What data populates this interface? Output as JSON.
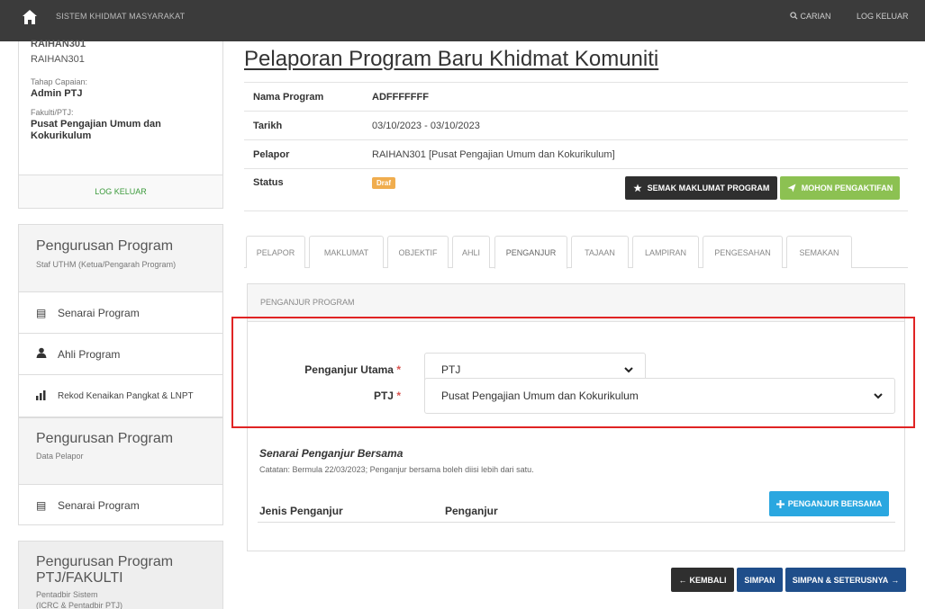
{
  "topbar": {
    "brand": "SISTEM KHIDMAT MASYARAKAT",
    "search": "CARIAN",
    "logout": "LOG KELUAR"
  },
  "profile": {
    "name_cut": "RAIHAN301",
    "username": "RAIHAN301",
    "level_label": "Tahap Capaian:",
    "level": "Admin PTJ",
    "faculty_label": "Fakulti/PTJ:",
    "faculty": "Pusat Pengajian Umum dan Kokurikulum",
    "logout": "LOG KELUAR"
  },
  "sidebar": {
    "section1": {
      "title": "Pengurusan Program",
      "subtitle": "Staf UTHM (Ketua/Pengarah Program)",
      "items": [
        "Senarai Program",
        "Ahli Program",
        "Rekod Kenaikan Pangkat & LNPT"
      ]
    },
    "section2": {
      "title": "Pengurusan Program",
      "subtitle": "Data Pelapor",
      "items": [
        "Senarai Program"
      ]
    },
    "section3": {
      "title": "Pengurusan Program",
      "title2": "PTJ/FAKULTI",
      "subtitle": "Pentadbir Sistem",
      "subtitle2": "(ICRC & Pentadbir PTJ)"
    }
  },
  "page": {
    "title": "Pelaporan Program Baru Khidmat Komuniti"
  },
  "info": {
    "program_label": "Nama Program",
    "program": "ADFFFFFFF",
    "date_label": "Tarikh",
    "date": "03/10/2023 - 03/10/2023",
    "reporter_label": "Pelapor",
    "reporter": "RAIHAN301 [Pusat Pengajian Umum dan Kokurikulum]",
    "status_label": "Status",
    "status": "Draf"
  },
  "actions": {
    "check": "SEMAK MAKLUMAT PROGRAM",
    "activate": "MOHON PENGAKTIFAN"
  },
  "tabs": [
    "PELAPOR",
    "MAKLUMAT",
    "OBJEKTIF",
    "AHLI",
    "PENGANJUR",
    "TAJAAN",
    "LAMPIRAN",
    "PENGESAHAN",
    "SEMAKAN"
  ],
  "panel": {
    "header": "PENGANJUR PROGRAM",
    "main_organizer_label": "Penganjur Utama",
    "main_organizer_value": "PTJ",
    "ptj_label": "PTJ",
    "ptj_value": "Pusat Pengajian Umum dan Kokurikulum",
    "required_mark": "*",
    "co_title": "Senarai Penganjur Bersama",
    "co_note": "Catatan: Bermula 22/03/2023; Penganjur bersama boleh diisi lebih dari satu.",
    "col_type": "Jenis Penganjur",
    "col_org": "Penganjur",
    "add_button": "PENGANJUR BERSAMA"
  },
  "footer": {
    "back": "KEMBALI",
    "save": "SIMPAN",
    "save_next": "SIMPAN & SETERUSNYA"
  },
  "colors": {
    "topbar": "#3b3b3b",
    "dark_button": "#2f2f2f",
    "green_button": "#8cc152",
    "blue_button": "#2aa7e0",
    "navy_button": "#1f4e8a",
    "badge": "#f0ad4e",
    "highlight": "#e02424"
  }
}
